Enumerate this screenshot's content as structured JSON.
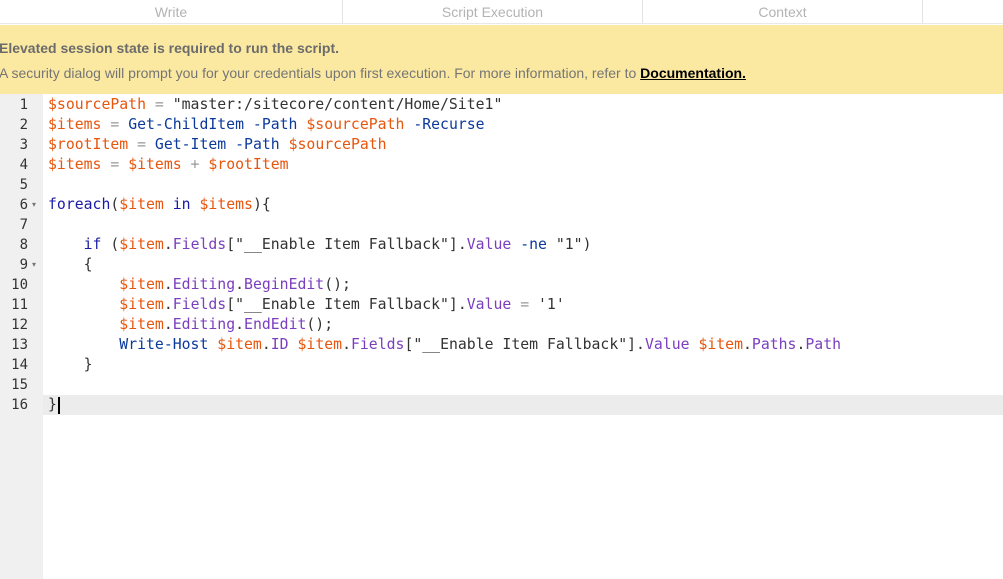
{
  "tabs": [
    "Write",
    "Script Execution",
    "Context",
    ""
  ],
  "warning": {
    "title": "Elevated session state is required to run the script.",
    "message": "A security dialog will prompt you for your credentials upon first execution. For more information, refer to ",
    "link": "Documentation."
  },
  "editor": {
    "line_numbers": [
      "1",
      "2",
      "3",
      "4",
      "5",
      "6",
      "7",
      "8",
      "9",
      "10",
      "11",
      "12",
      "13",
      "14",
      "15",
      "16"
    ],
    "folded_lines": [
      6,
      9
    ],
    "active_line": 16,
    "lines": [
      [
        [
          "v",
          "$sourcePath"
        ],
        [
          "o",
          " = "
        ],
        [
          "s",
          "\"master:/sitecore/content/Home/Site1\""
        ]
      ],
      [
        [
          "v",
          "$items"
        ],
        [
          "o",
          " = "
        ],
        [
          "c",
          "Get-ChildItem"
        ],
        [
          "s",
          " "
        ],
        [
          "c",
          "-Path"
        ],
        [
          "s",
          " "
        ],
        [
          "v",
          "$sourcePath"
        ],
        [
          "s",
          " "
        ],
        [
          "c",
          "-Recurse"
        ]
      ],
      [
        [
          "v",
          "$rootItem"
        ],
        [
          "o",
          " = "
        ],
        [
          "c",
          "Get-Item"
        ],
        [
          "s",
          " "
        ],
        [
          "c",
          "-Path"
        ],
        [
          "s",
          " "
        ],
        [
          "v",
          "$sourcePath"
        ]
      ],
      [
        [
          "v",
          "$items"
        ],
        [
          "o",
          " = "
        ],
        [
          "v",
          "$items"
        ],
        [
          "o",
          " + "
        ],
        [
          "v",
          "$rootItem"
        ]
      ],
      [],
      [
        [
          "k",
          "foreach"
        ],
        [
          "s",
          "("
        ],
        [
          "v",
          "$item"
        ],
        [
          "s",
          " "
        ],
        [
          "k",
          "in"
        ],
        [
          "s",
          " "
        ],
        [
          "v",
          "$items"
        ],
        [
          "s",
          ")"
        ],
        [
          "s",
          "{"
        ]
      ],
      [],
      [
        [
          "s",
          "    "
        ],
        [
          "k",
          "if"
        ],
        [
          "s",
          " ("
        ],
        [
          "v",
          "$item"
        ],
        [
          "s",
          "."
        ],
        [
          "p",
          "Fields"
        ],
        [
          "s",
          "[\"__Enable Item Fallback\"]."
        ],
        [
          "p",
          "Value"
        ],
        [
          "s",
          " "
        ],
        [
          "c",
          "-ne"
        ],
        [
          "s",
          " \"1\")"
        ]
      ],
      [
        [
          "s",
          "    {"
        ]
      ],
      [
        [
          "s",
          "        "
        ],
        [
          "v",
          "$item"
        ],
        [
          "s",
          "."
        ],
        [
          "p",
          "Editing"
        ],
        [
          "s",
          "."
        ],
        [
          "p",
          "BeginEdit"
        ],
        [
          "s",
          "();"
        ]
      ],
      [
        [
          "s",
          "        "
        ],
        [
          "v",
          "$item"
        ],
        [
          "s",
          "."
        ],
        [
          "p",
          "Fields"
        ],
        [
          "s",
          "[\"__Enable Item Fallback\"]."
        ],
        [
          "p",
          "Value"
        ],
        [
          "o",
          " = "
        ],
        [
          "s",
          "'1'"
        ]
      ],
      [
        [
          "s",
          "        "
        ],
        [
          "v",
          "$item"
        ],
        [
          "s",
          "."
        ],
        [
          "p",
          "Editing"
        ],
        [
          "s",
          "."
        ],
        [
          "p",
          "EndEdit"
        ],
        [
          "s",
          "();"
        ]
      ],
      [
        [
          "s",
          "        "
        ],
        [
          "c",
          "Write-Host"
        ],
        [
          "s",
          " "
        ],
        [
          "v",
          "$item"
        ],
        [
          "s",
          "."
        ],
        [
          "p",
          "ID"
        ],
        [
          "s",
          " "
        ],
        [
          "v",
          "$item"
        ],
        [
          "s",
          "."
        ],
        [
          "p",
          "Fields"
        ],
        [
          "s",
          "[\"__Enable Item Fallback\"]."
        ],
        [
          "p",
          "Value"
        ],
        [
          "s",
          " "
        ],
        [
          "v",
          "$item"
        ],
        [
          "s",
          "."
        ],
        [
          "p",
          "Paths"
        ],
        [
          "s",
          "."
        ],
        [
          "p",
          "Path"
        ]
      ],
      [
        [
          "s",
          "    }"
        ]
      ],
      [],
      [
        [
          "s",
          "}"
        ]
      ]
    ]
  }
}
